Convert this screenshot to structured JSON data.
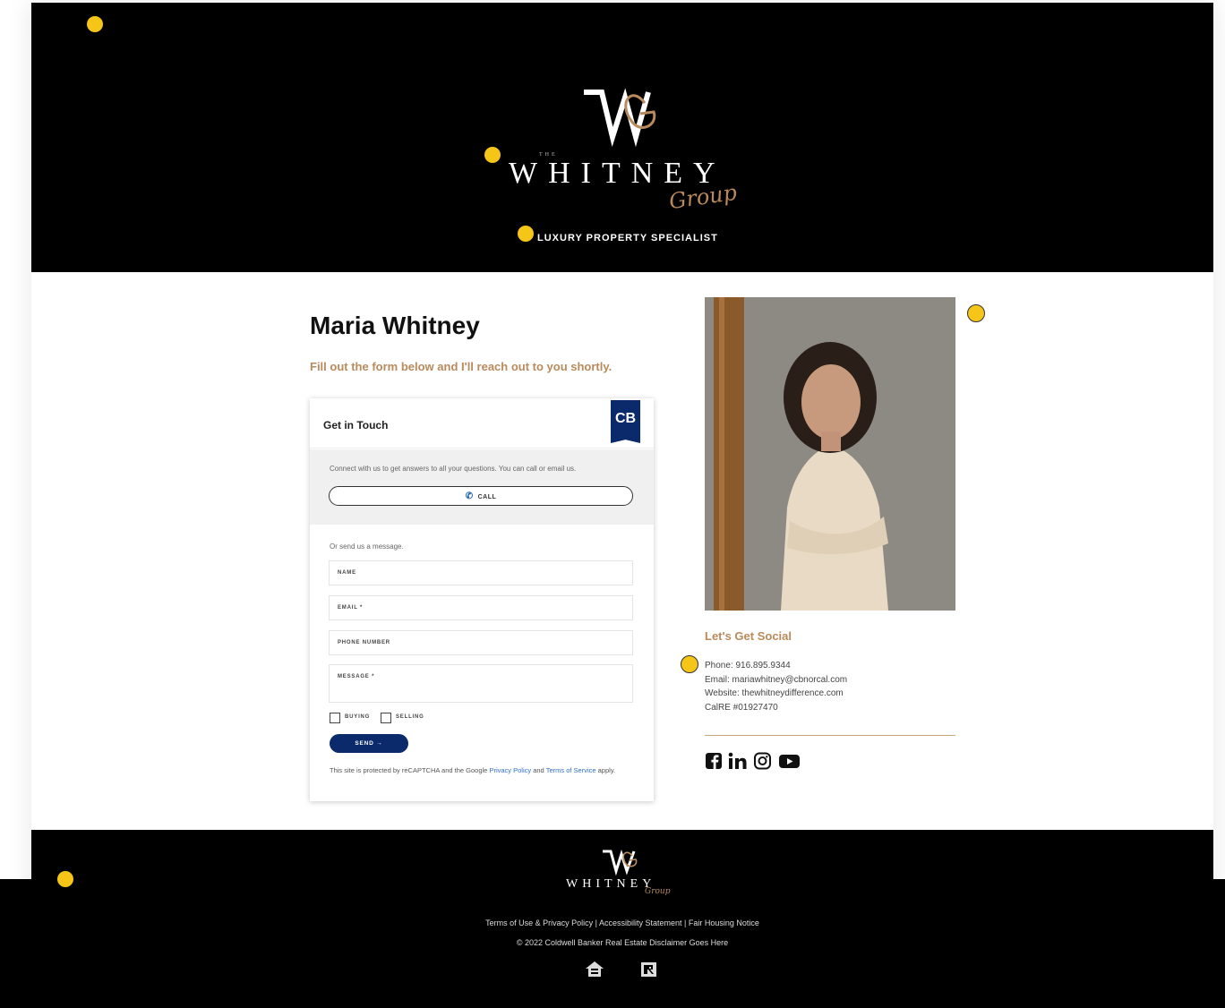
{
  "brand": {
    "logo_the": "THE",
    "logo_word": "WHITNEY",
    "logo_script": "Group",
    "tagline": "LUXURY PROPERTY SPECIALIST"
  },
  "agent": {
    "name": "Maria Whitney",
    "intro": "Fill out the form below and I'll reach out to you shortly."
  },
  "contact_form": {
    "title": "Get in Touch",
    "badge_icon": "coldwell-banker-badge-icon",
    "call_prompt": "Connect with us to get answers to all your questions. You can call or email us.",
    "call_label": "CALL",
    "message_prompt": "Or send us a message.",
    "fields": {
      "name": "NAME",
      "email": "EMAIL *",
      "phone": "PHONE NUMBER",
      "message": "MESSAGE *"
    },
    "options": {
      "buying": "BUYING",
      "selling": "SELLING"
    },
    "send_label": "SEND",
    "legal": {
      "prefix": "This site is protected by reCAPTCHA and the Google",
      "privacy": "Privacy Policy",
      "and": "and",
      "terms": "Terms of Service",
      "suffix": "apply."
    }
  },
  "social": {
    "title": "Let's Get Social",
    "phone": "Phone: 916.895.9344",
    "email": "Email: mariawhitney@cbnorcal.com",
    "website": "Website: thewhitneydifference.com",
    "license": "CalRE #01927470",
    "icons": [
      "facebook-icon",
      "linkedin-icon",
      "instagram-icon",
      "youtube-icon"
    ]
  },
  "footer": {
    "logo_word": "WHITNEY",
    "logo_script": "Group",
    "links": "Terms of Use & Privacy Policy | Accessibility Statement | Fair Housing Notice",
    "copyright": "© 2022 Coldwell Banker Real Estate Disclaimer Goes Here",
    "icons": [
      "equal-housing-icon",
      "realtor-icon"
    ]
  },
  "colors": {
    "gold": "#b98a5b",
    "navy": "#0a2a6b",
    "highlight": "#f5c518"
  }
}
